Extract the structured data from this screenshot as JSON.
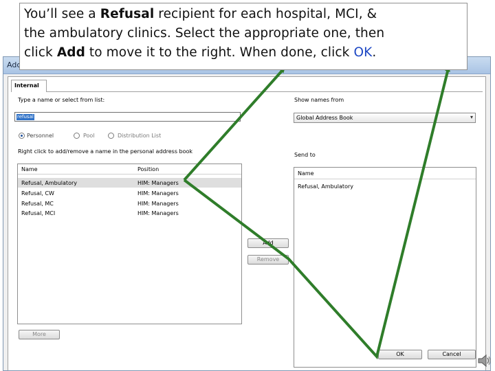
{
  "caption": {
    "line1_pre": "You’ll see a ",
    "line1_bold": "Refusal",
    "line1_post": " recipient for each hospital, MCI, &",
    "line2": "the ambulatory clinics.  Select the appropriate one, then",
    "line3_pre": "click ",
    "line3_bold": "Add",
    "line3_mid": " to move it to the right.  When done, click ",
    "line3_ok": "OK",
    "line3_end": "."
  },
  "window": {
    "title_fragment": "Adc"
  },
  "tabs": [
    "Internal"
  ],
  "left_panel": {
    "type_label": "Type a name or select from list:",
    "search_value": "refusal",
    "radios": [
      {
        "label": "Personnel",
        "selected": true
      },
      {
        "label": "Pool",
        "selected": false
      },
      {
        "label": "Distribution List",
        "selected": false
      }
    ],
    "hint": "Right click to add/remove a name in the personal address book",
    "columns": [
      "Name",
      "Position"
    ],
    "rows": [
      {
        "name": "Refusal, Ambulatory",
        "position": "HIM: Managers",
        "selected": true
      },
      {
        "name": "Refusal, CW",
        "position": "HIM: Managers",
        "selected": false
      },
      {
        "name": "Refusal, MC",
        "position": "HIM: Managers",
        "selected": false
      },
      {
        "name": "Refusal, MCI",
        "position": "HIM: Managers",
        "selected": false
      }
    ],
    "more_button": "More"
  },
  "middle": {
    "add_button": "Add",
    "remove_button": "Remove"
  },
  "right_panel": {
    "show_names_label": "Show names from",
    "address_book": "Global Address Book",
    "send_to_label": "Send to",
    "columns": [
      "Name"
    ],
    "rows": [
      {
        "name": "Refusal, Ambulatory"
      }
    ]
  },
  "footer": {
    "ok_button": "OK",
    "cancel_button": "Cancel"
  },
  "colors": {
    "arrow": "#2f7d2a",
    "accent_blue": "#1d47c4",
    "selection": "#3072c7"
  },
  "icons": {
    "speaker": "speaker-icon",
    "dropdown": "chevron-down-icon"
  }
}
